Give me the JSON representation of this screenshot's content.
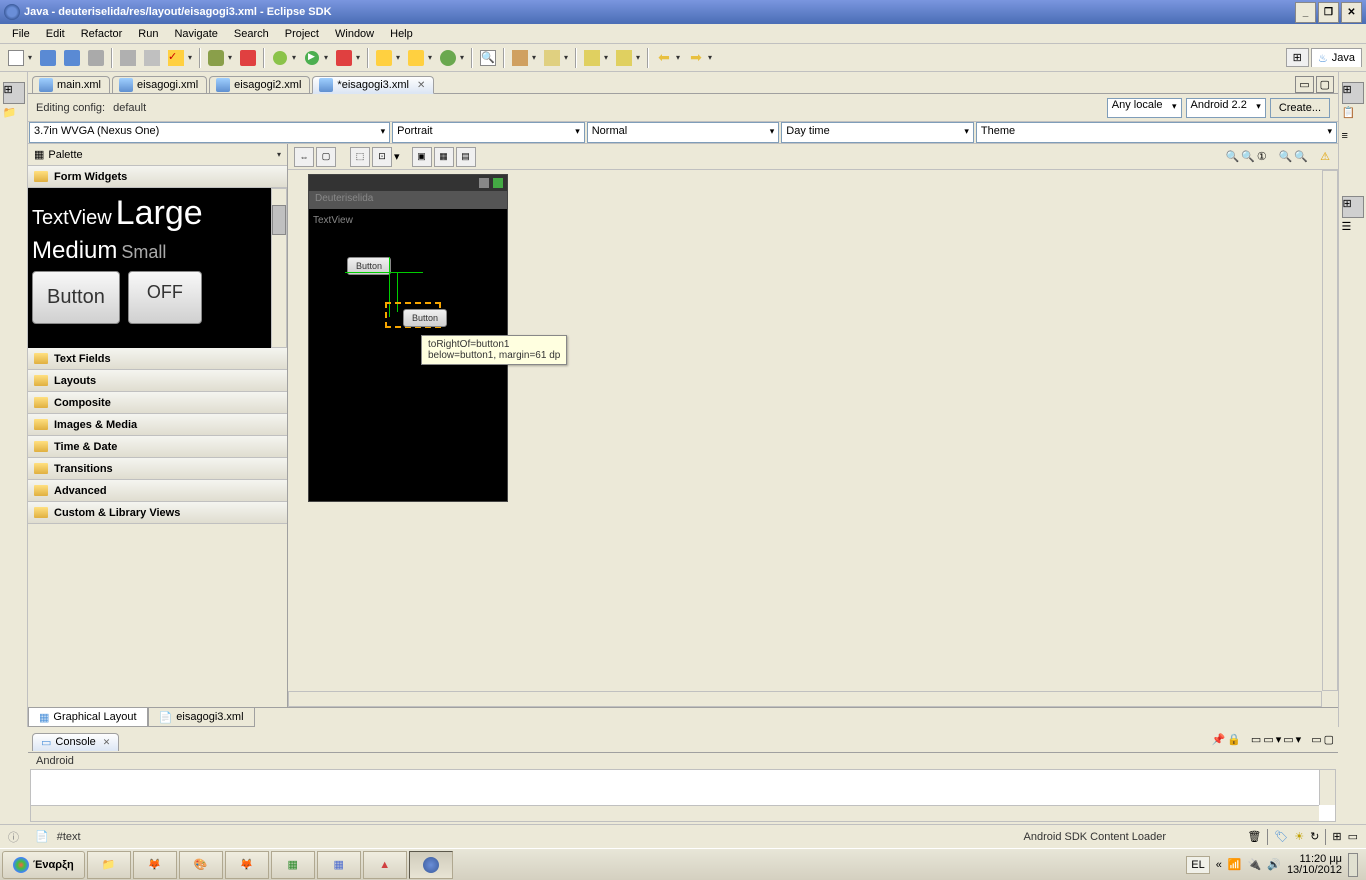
{
  "titlebar": {
    "text": "Java - deuteriselida/res/layout/eisagogi3.xml - Eclipse SDK"
  },
  "menu": {
    "items": [
      "File",
      "Edit",
      "Refactor",
      "Run",
      "Navigate",
      "Search",
      "Project",
      "Window",
      "Help"
    ]
  },
  "perspective": {
    "java": "Java"
  },
  "tabs": [
    {
      "label": "main.xml",
      "active": false
    },
    {
      "label": "eisagogi.xml",
      "active": false
    },
    {
      "label": "eisagogi2.xml",
      "active": false
    },
    {
      "label": "*eisagogi3.xml",
      "active": true
    }
  ],
  "editing_config": {
    "label": "Editing config:",
    "value": "default"
  },
  "locale_combo": "Any locale",
  "platform_combo": "Android 2.2",
  "create_btn": "Create...",
  "device_row": {
    "device": "3.7in WVGA (Nexus One)",
    "orientation": "Portrait",
    "mode": "Normal",
    "daynight": "Day time",
    "theme": "Theme"
  },
  "palette": {
    "title": "Palette",
    "categories": [
      "Form Widgets",
      "Text Fields",
      "Layouts",
      "Composite",
      "Images & Media",
      "Time & Date",
      "Transitions",
      "Advanced",
      "Custom & Library Views"
    ],
    "widgets": {
      "textview": "TextView",
      "large": "Large",
      "medium": "Medium",
      "small": "Small",
      "button": "Button",
      "off": "OFF"
    }
  },
  "device_preview": {
    "app_title": "Deuteriselida",
    "textview": "TextView",
    "button1": "Button",
    "button2": "Button",
    "tooltip": "toRightOf=button1\nbelow=button1, margin=61 dp"
  },
  "bottom_tabs": {
    "graphical": "Graphical Layout",
    "xml": "eisagogi3.xml"
  },
  "console": {
    "tab": "Console",
    "title": "Android"
  },
  "statusbar": {
    "text_item": "#text",
    "loader": "Android SDK Content Loader"
  },
  "taskbar": {
    "start": "Έναρξη",
    "lang": "EL",
    "time": "11:20 μμ",
    "date": "13/10/2012"
  }
}
